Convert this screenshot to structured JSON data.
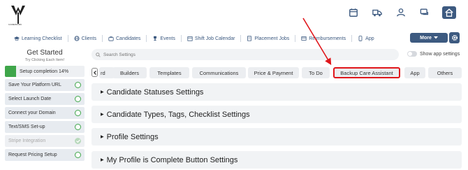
{
  "brand": {
    "logo_text": "CAREWORK"
  },
  "top_icons": [
    "calendar-icon",
    "truck-icon",
    "users-icon",
    "chat-icon",
    "home-icon"
  ],
  "nav": {
    "items": [
      {
        "label": "Learning Checklist",
        "icon": "graduation-icon"
      },
      {
        "label": "Clients",
        "icon": "globe-icon"
      },
      {
        "label": "Candidates",
        "icon": "briefcase-icon"
      },
      {
        "label": "Events",
        "icon": "trophy-icon"
      },
      {
        "label": "Shift Job Calendar",
        "icon": "calendar-icon"
      },
      {
        "label": "Placement Jobs",
        "icon": "building-icon"
      },
      {
        "label": "Reimbursements",
        "icon": "receipt-icon"
      },
      {
        "label": "App",
        "icon": "phone-icon"
      }
    ],
    "more_label": "More"
  },
  "sidebar": {
    "title": "Get Started",
    "subtitle": "Try Clicking Each Item!",
    "progress_label": "Setup completion 14%",
    "progress_fraction": 0.14,
    "items": [
      {
        "label": "Save Your Platform URL",
        "done": false
      },
      {
        "label": "Select Launch Date",
        "done": false
      },
      {
        "label": "Connect your Domain",
        "done": false
      },
      {
        "label": "Text/SMS Set-up",
        "done": false
      },
      {
        "label": "Stripe Integration",
        "done": true
      },
      {
        "label": "Request Pricing Setup",
        "done": false
      }
    ]
  },
  "search": {
    "placeholder": "Search Settings"
  },
  "toggle_label": "Show app settings",
  "tabs": [
    {
      "label": "rd"
    },
    {
      "label": "Builders"
    },
    {
      "label": "Templates"
    },
    {
      "label": "Communications"
    },
    {
      "label": "Price & Payment"
    },
    {
      "label": "To Do"
    },
    {
      "label": "Backup Care Assistant",
      "highlighted": true
    },
    {
      "label": "App"
    },
    {
      "label": "Others"
    }
  ],
  "sections": [
    {
      "label": "Candidate Statuses Settings"
    },
    {
      "label": "Candidate Types, Tags, Checklist Settings"
    },
    {
      "label": "Profile Settings"
    },
    {
      "label": "My Profile is Complete Button Settings"
    }
  ],
  "colors": {
    "accent": "#3d5a80",
    "highlight": "#e0161b",
    "success": "#3fa64a"
  }
}
